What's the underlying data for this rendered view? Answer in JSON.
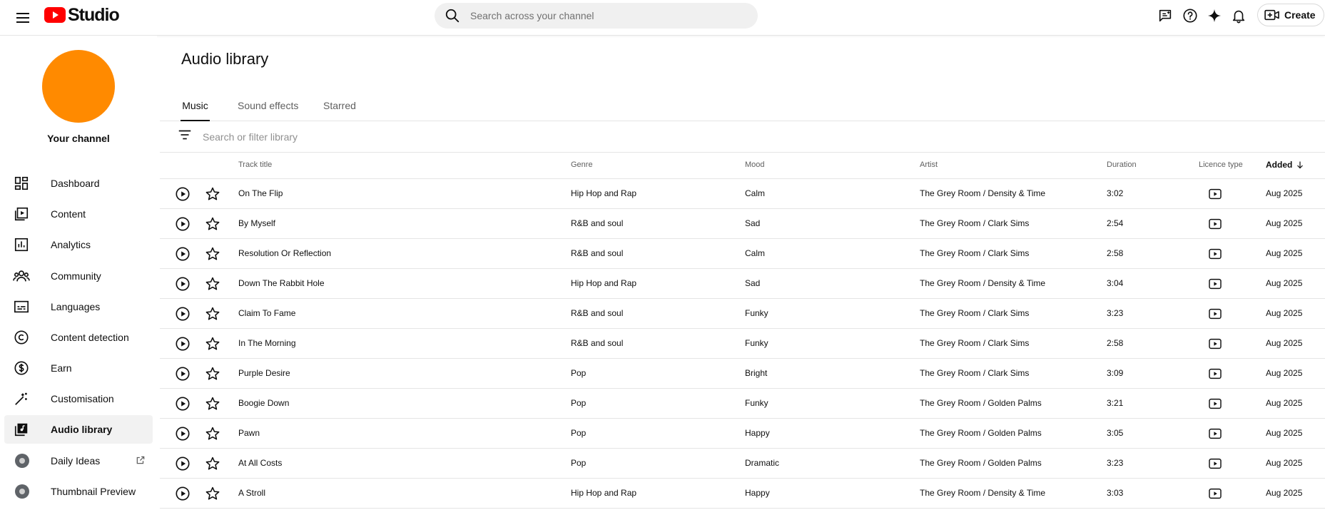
{
  "header": {
    "logo_text": "Studio",
    "search_placeholder": "Search across your channel",
    "create_label": "Create"
  },
  "sidebar": {
    "channel_label": "Your channel",
    "avatar_color": "#ff8a00",
    "items": [
      {
        "label": "Dashboard",
        "icon": "dashboard-icon"
      },
      {
        "label": "Content",
        "icon": "content-icon"
      },
      {
        "label": "Analytics",
        "icon": "analytics-icon"
      },
      {
        "label": "Community",
        "icon": "community-icon"
      },
      {
        "label": "Languages",
        "icon": "subtitles-icon"
      },
      {
        "label": "Content detection",
        "icon": "copyright-icon"
      },
      {
        "label": "Earn",
        "icon": "dollar-icon"
      },
      {
        "label": "Customisation",
        "icon": "magic-wand-icon"
      },
      {
        "label": "Audio library",
        "icon": "audio-library-icon",
        "active": true
      },
      {
        "label": "Daily Ideas",
        "icon": "extension-icon",
        "external": true
      },
      {
        "label": "Thumbnail Preview",
        "icon": "extension-icon"
      }
    ]
  },
  "main": {
    "title": "Audio library",
    "tabs": [
      {
        "label": "Music",
        "active": true
      },
      {
        "label": "Sound effects"
      },
      {
        "label": "Starred"
      }
    ],
    "filter_placeholder": "Search or filter library",
    "columns": {
      "title": "Track title",
      "genre": "Genre",
      "mood": "Mood",
      "artist": "Artist",
      "duration": "Duration",
      "licence": "Licence type",
      "added": "Added"
    },
    "rows": [
      {
        "title": "On The Flip",
        "genre": "Hip Hop and Rap",
        "mood": "Calm",
        "artist": "The Grey Room / Density & Time",
        "duration": "3:02",
        "added": "Aug 2025"
      },
      {
        "title": "By Myself",
        "genre": "R&B and soul",
        "mood": "Sad",
        "artist": "The Grey Room / Clark Sims",
        "duration": "2:54",
        "added": "Aug 2025"
      },
      {
        "title": "Resolution Or Reflection",
        "genre": "R&B and soul",
        "mood": "Calm",
        "artist": "The Grey Room / Clark Sims",
        "duration": "2:58",
        "added": "Aug 2025"
      },
      {
        "title": "Down The Rabbit Hole",
        "genre": "Hip Hop and Rap",
        "mood": "Sad",
        "artist": "The Grey Room / Density & Time",
        "duration": "3:04",
        "added": "Aug 2025"
      },
      {
        "title": "Claim To Fame",
        "genre": "R&B and soul",
        "mood": "Funky",
        "artist": "The Grey Room / Clark Sims",
        "duration": "3:23",
        "added": "Aug 2025"
      },
      {
        "title": "In The Morning",
        "genre": "R&B and soul",
        "mood": "Funky",
        "artist": "The Grey Room / Clark Sims",
        "duration": "2:58",
        "added": "Aug 2025"
      },
      {
        "title": "Purple Desire",
        "genre": "Pop",
        "mood": "Bright",
        "artist": "The Grey Room / Clark Sims",
        "duration": "3:09",
        "added": "Aug 2025"
      },
      {
        "title": "Boogie Down",
        "genre": "Pop",
        "mood": "Funky",
        "artist": "The Grey Room / Golden Palms",
        "duration": "3:21",
        "added": "Aug 2025"
      },
      {
        "title": "Pawn",
        "genre": "Pop",
        "mood": "Happy",
        "artist": "The Grey Room / Golden Palms",
        "duration": "3:05",
        "added": "Aug 2025"
      },
      {
        "title": "At All Costs",
        "genre": "Pop",
        "mood": "Dramatic",
        "artist": "The Grey Room / Golden Palms",
        "duration": "3:23",
        "added": "Aug 2025"
      },
      {
        "title": "A Stroll",
        "genre": "Hip Hop and Rap",
        "mood": "Happy",
        "artist": "The Grey Room / Density & Time",
        "duration": "3:03",
        "added": "Aug 2025"
      }
    ]
  }
}
